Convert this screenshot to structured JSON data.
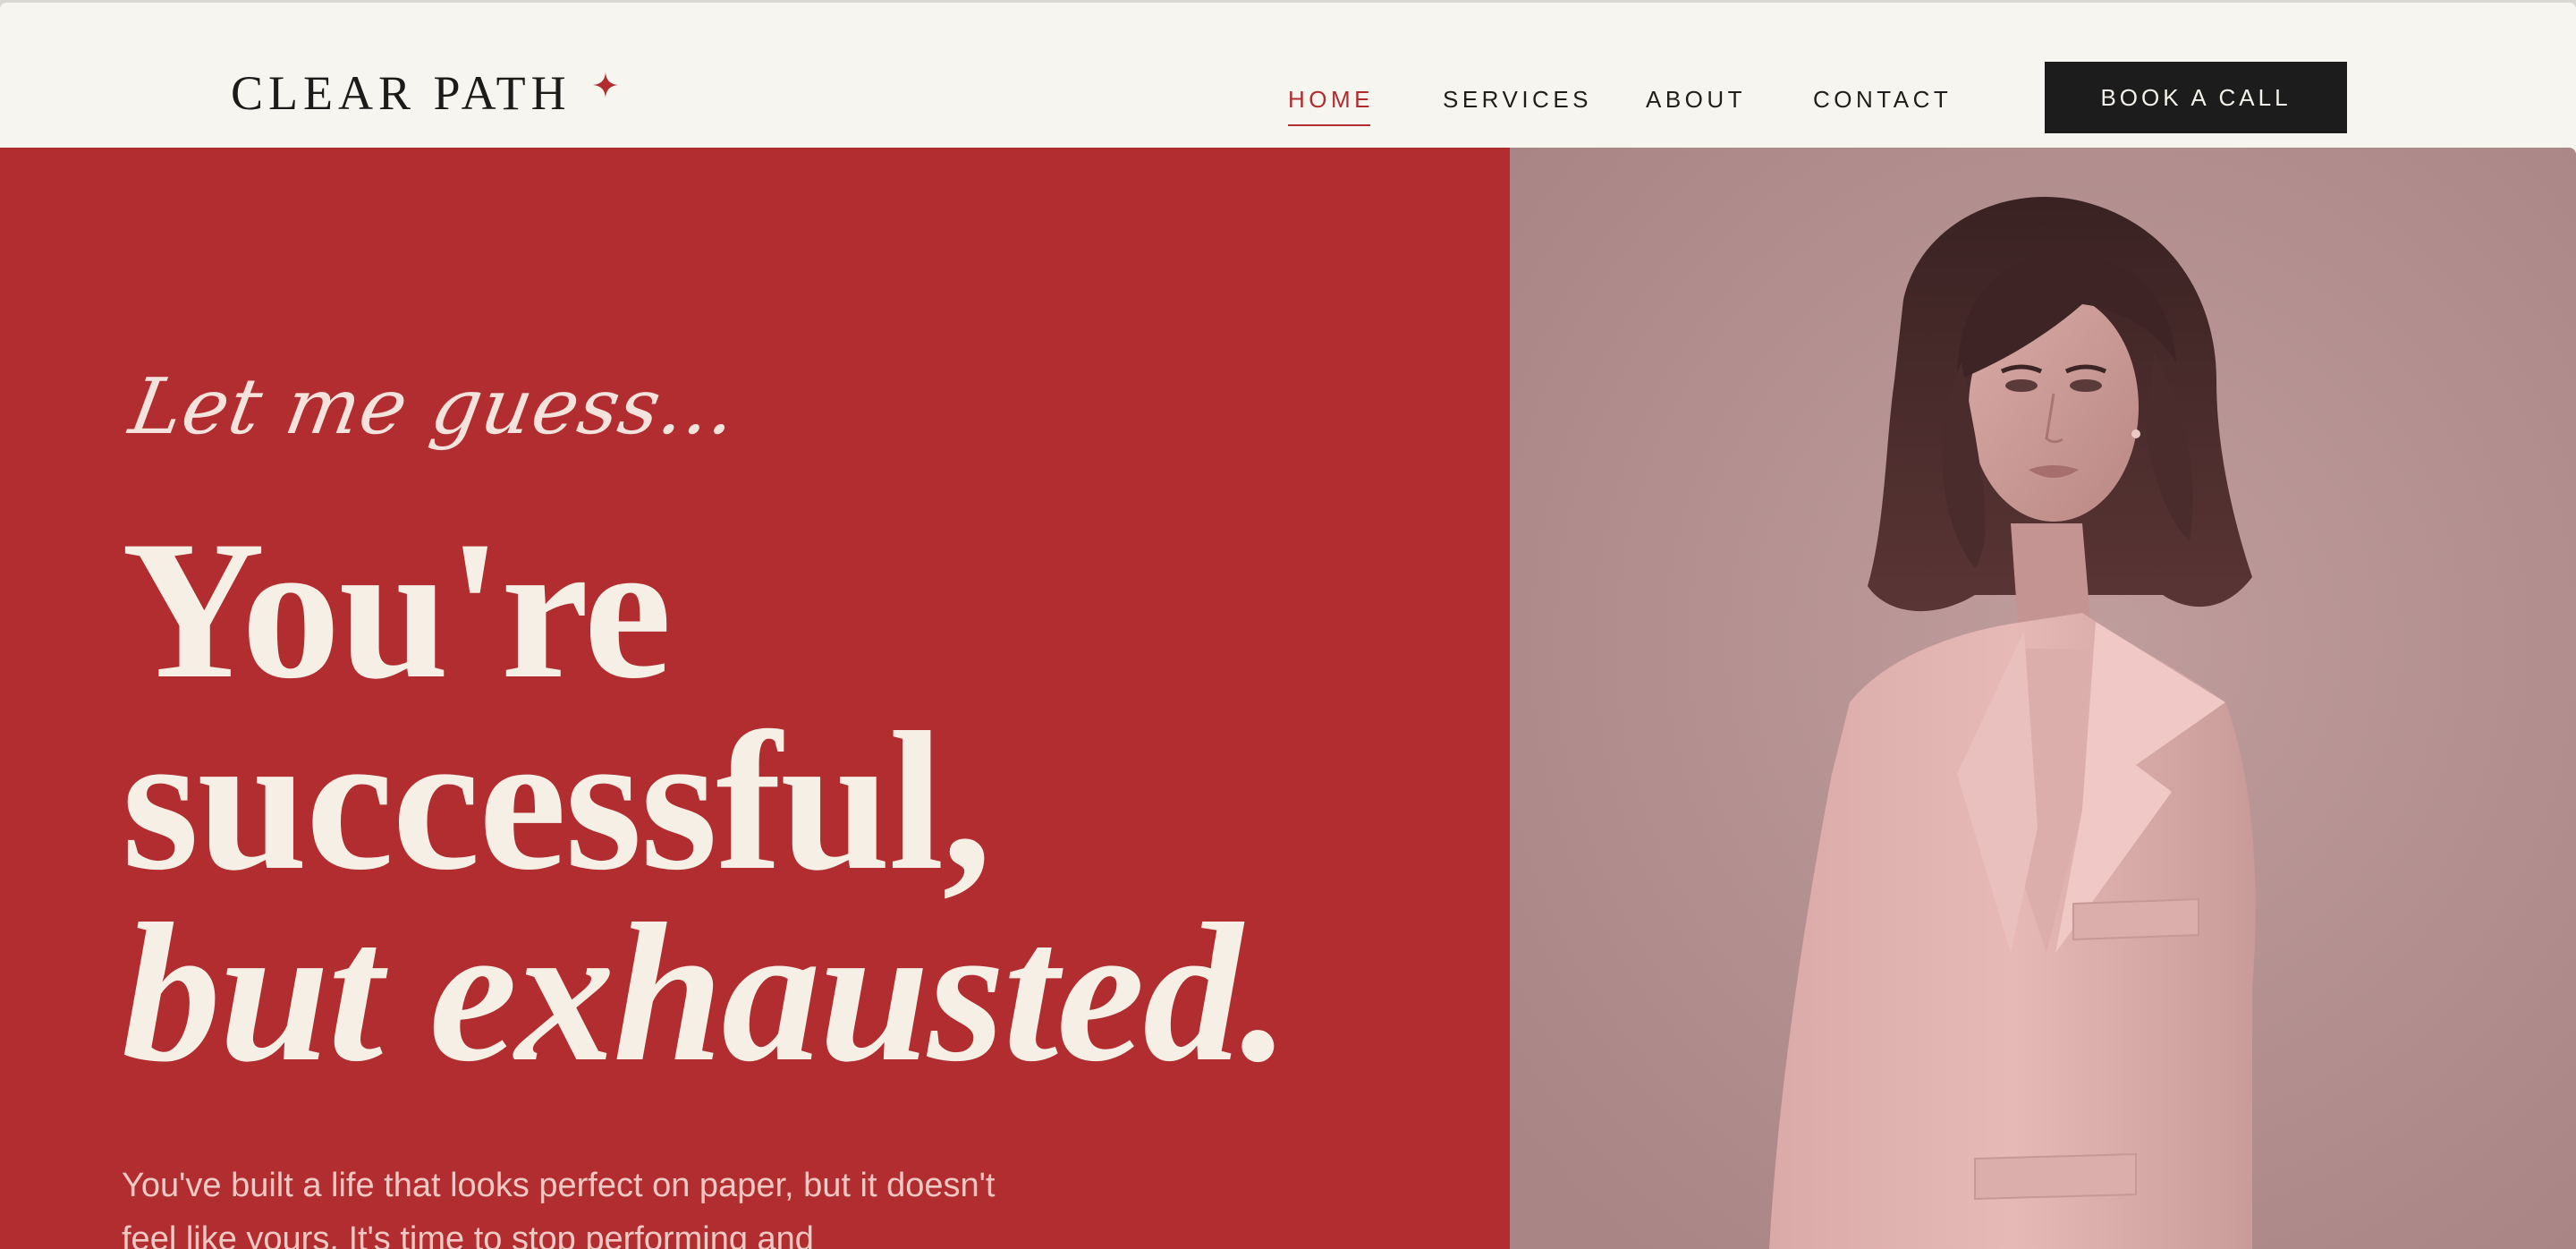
{
  "brand": {
    "name": "CLEAR PATH",
    "star_icon": "sparkle-icon",
    "accent_color": "#b02c2f"
  },
  "nav": {
    "items": [
      {
        "label": "HOME",
        "active": true
      },
      {
        "label": "SERVICES",
        "active": false
      },
      {
        "label": "ABOUT",
        "active": false
      },
      {
        "label": "CONTACT",
        "active": false
      }
    ],
    "cta_label": "BOOK A CALL"
  },
  "hero": {
    "eyebrow": "Let me guess...",
    "headline_line1": "You're",
    "headline_line2": "successful,",
    "headline_line3": "but exhausted.",
    "body": "You've built a life that looks perfect on paper, but it doesn't feel like yours. It's time to stop performing and",
    "background_color": "#b12d2f",
    "portrait_alt": "portrait of a woman in a pink blazer"
  }
}
